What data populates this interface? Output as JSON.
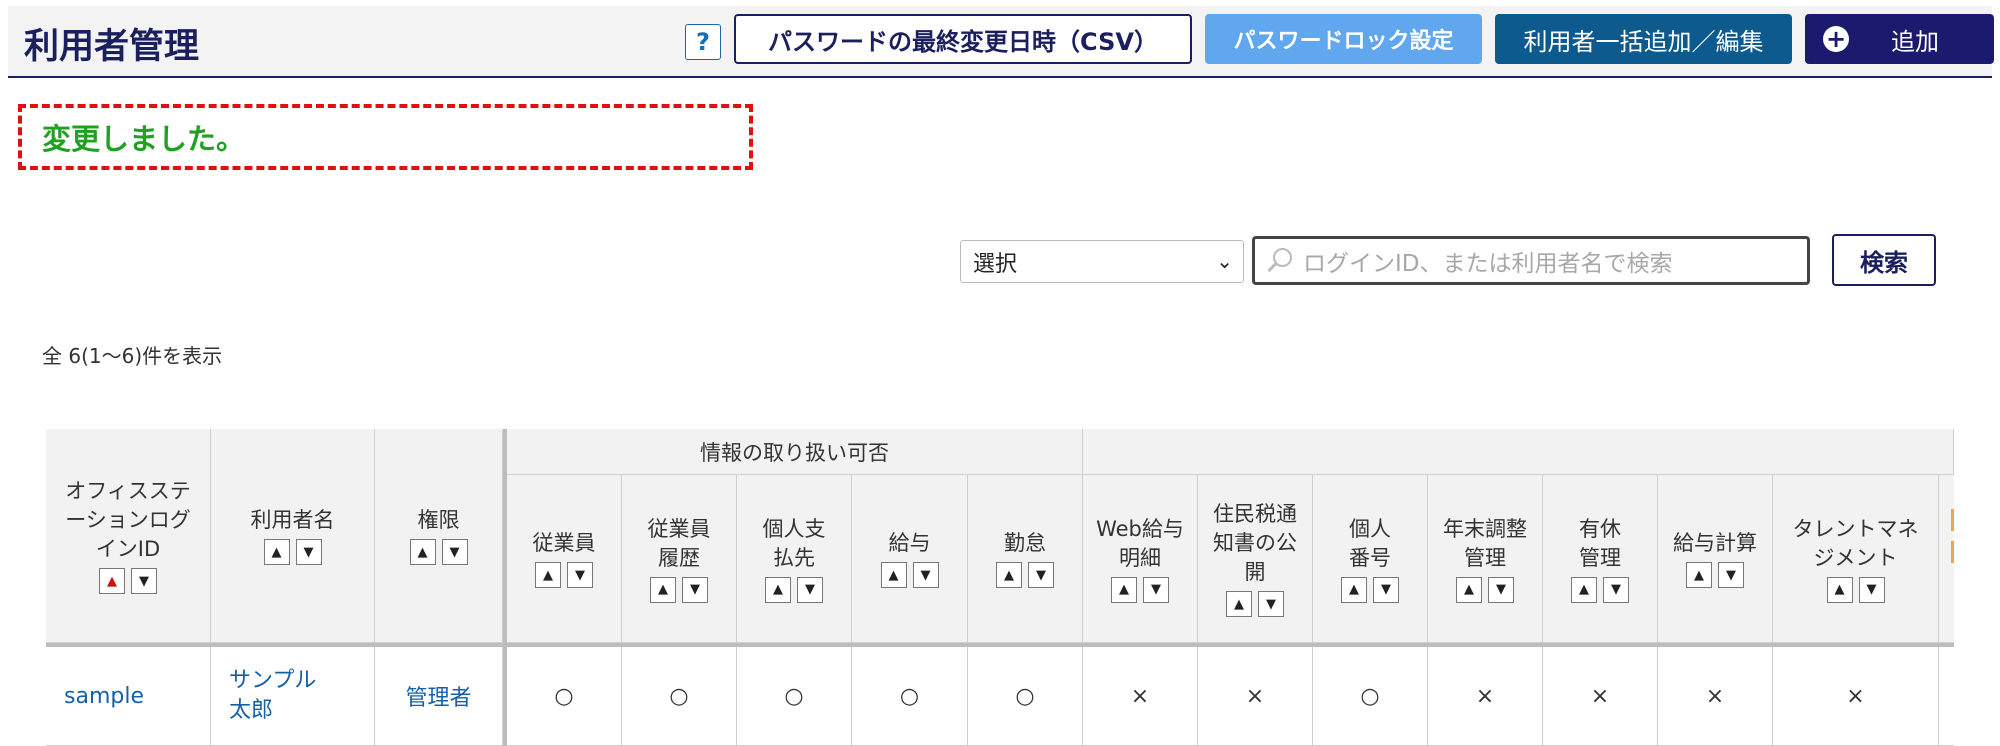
{
  "header": {
    "title": "利用者管理",
    "help_label": "?",
    "csv_button": "パスワードの最終変更日時（CSV）",
    "lock_button": "パスワードロック設定",
    "bulk_button": "利用者一括追加／編集",
    "add_button": "追加",
    "add_icon": "+"
  },
  "flash": {
    "message": "変更しました。"
  },
  "search": {
    "select_value": "選択",
    "placeholder": "ログインID、または利用者名で検索",
    "button": "検索"
  },
  "summary": {
    "count_text": "全 6(1～6)件を表示"
  },
  "table": {
    "group_header": "情報の取り扱い可否",
    "columns": {
      "login_id": "オフィスステーションログインID",
      "user_name": "利用者名",
      "role": "権限",
      "employee": "従業員",
      "employee_history": "従業員履歴",
      "individual_payee": "個人支払先",
      "salary": "給与",
      "attendance": "勤怠",
      "web_payslip": "Web給与明細",
      "resident_tax": "住民税通知書の公開",
      "personal_number": "個人番号",
      "year_end": "年末調整管理",
      "paid_leave": "有休管理",
      "payroll": "給与計算",
      "talent": "タレントマネジメント"
    },
    "rows": [
      {
        "login_id": "sample",
        "user_name": "サンプル　太郎",
        "role": "管理者",
        "employee": "○",
        "employee_history": "○",
        "individual_payee": "○",
        "salary": "○",
        "attendance": "○",
        "web_payslip": "×",
        "resident_tax": "×",
        "personal_number": "○",
        "year_end": "×",
        "paid_leave": "×",
        "payroll": "×",
        "talent": "×"
      }
    ]
  },
  "icons": {
    "sort_up": "up-arrow",
    "sort_down": "down-arrow",
    "search": "magnifier"
  },
  "colors": {
    "brand_navy": "#1b1f5e",
    "lock_button": "#61a7f0",
    "bulk_button": "#0c5a8e",
    "success_text": "#21a121",
    "flash_border": "#e01010",
    "link": "#1560a8",
    "active_sort": "#d01010"
  }
}
